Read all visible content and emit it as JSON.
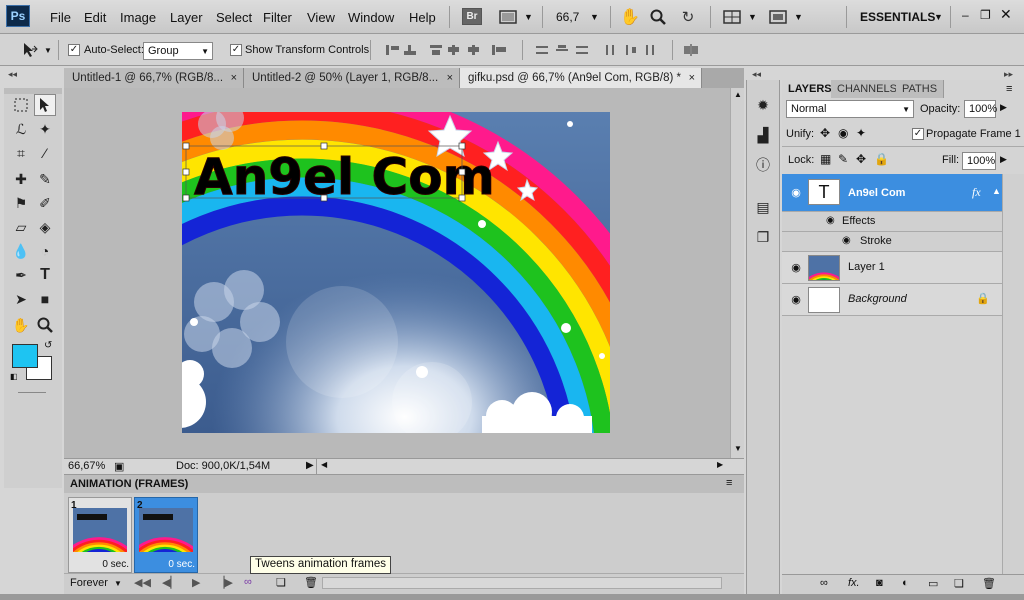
{
  "app": {
    "logo_text": "Ps"
  },
  "menu": [
    "File",
    "Edit",
    "Image",
    "Layer",
    "Select",
    "Filter",
    "View",
    "Window",
    "Help"
  ],
  "appbar": {
    "bridge_label": "Br",
    "zoom": "66,7",
    "workspace": "ESSENTIALS"
  },
  "options": {
    "auto_select_label": "Auto-Select:",
    "auto_select_value": "Group",
    "transform_label": "Show Transform Controls"
  },
  "tabs": [
    {
      "label": "Untitled-1 @ 66,7% (RGB/8...",
      "close": "×"
    },
    {
      "label": "Untitled-2 @ 50% (Layer 1, RGB/8...",
      "close": "×"
    },
    {
      "label": "gifku.psd @ 66,7% (An9el Com, RGB/8) *",
      "close": "×"
    }
  ],
  "canvas": {
    "title_text": "An9el Com"
  },
  "status": {
    "zoom": "66,67%",
    "doc": "Doc: 900,0K/1,54M"
  },
  "animation": {
    "title": "ANIMATION (FRAMES)",
    "frames": [
      {
        "num": "1",
        "duration": "0 sec."
      },
      {
        "num": "2",
        "duration": "0 sec."
      }
    ],
    "loop": "Forever",
    "tooltip": "Tweens animation frames"
  },
  "layers_panel": {
    "tabs": [
      "LAYERS",
      "CHANNELS",
      "PATHS"
    ],
    "blend_mode": "Normal",
    "opacity_label": "Opacity:",
    "opacity": "100%",
    "unify_label": "Unify:",
    "propagate_label": "Propagate Frame 1",
    "lock_label": "Lock:",
    "fill_label": "Fill:",
    "fill": "100%",
    "layers": [
      {
        "name": "An9el Com",
        "thumb": "T",
        "fx": "fx",
        "effects_label": "Effects",
        "stroke_label": "Stroke"
      },
      {
        "name": "Layer 1"
      },
      {
        "name": "Background"
      }
    ]
  },
  "colors": {
    "foreground": "#1ec4f2",
    "background": "#ffffff",
    "selection": "#3c8ee0"
  }
}
